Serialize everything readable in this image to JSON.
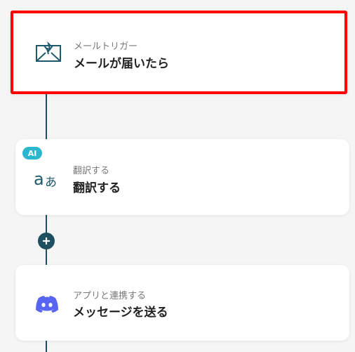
{
  "flow": {
    "trigger": {
      "subtitle": "メールトリガー",
      "title": "メールが届いたら",
      "icon": "mail-icon",
      "selected": true,
      "highlight_color": "#ff0000"
    },
    "translate": {
      "badge": "AI",
      "subtitle": "翻訳する",
      "title": "翻訳する",
      "icon": "translate-icon",
      "badge_color": "#2bb8cf"
    },
    "discord": {
      "subtitle": "アプリと連携する",
      "title": "メッセージを送る",
      "icon": "discord-icon",
      "brand_color": "#5865f2"
    },
    "add_step_icon": "plus-icon",
    "connector_color": "#1e4f60"
  }
}
